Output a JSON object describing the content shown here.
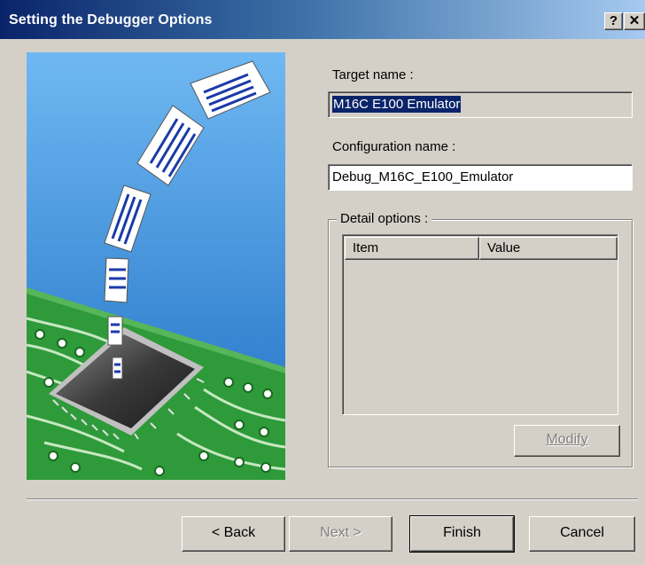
{
  "window": {
    "title": "Setting the Debugger Options",
    "help_label": "?",
    "close_label": "✕"
  },
  "target": {
    "label": "Target name :",
    "value": "M16C E100 Emulator"
  },
  "configuration": {
    "label": "Configuration name :",
    "value": "Debug_M16C_E100_Emulator"
  },
  "details": {
    "group_label": "Detail options :",
    "columns": [
      "Item",
      "Value"
    ],
    "modify_label": "Modify"
  },
  "buttons": {
    "back": "< Back",
    "next": "Next >",
    "finish": "Finish",
    "cancel": "Cancel"
  },
  "colors": {
    "titlebar_start": "#0a246a",
    "titlebar_end": "#a6caf0",
    "dialog_bg": "#d4d0c8",
    "selection": "#0a246a",
    "pcb_green": "#2e9a3a",
    "sky_blue": "#3b8ed8"
  },
  "illustration": {
    "description_icon": "pcb-chip-documents-illustration"
  }
}
